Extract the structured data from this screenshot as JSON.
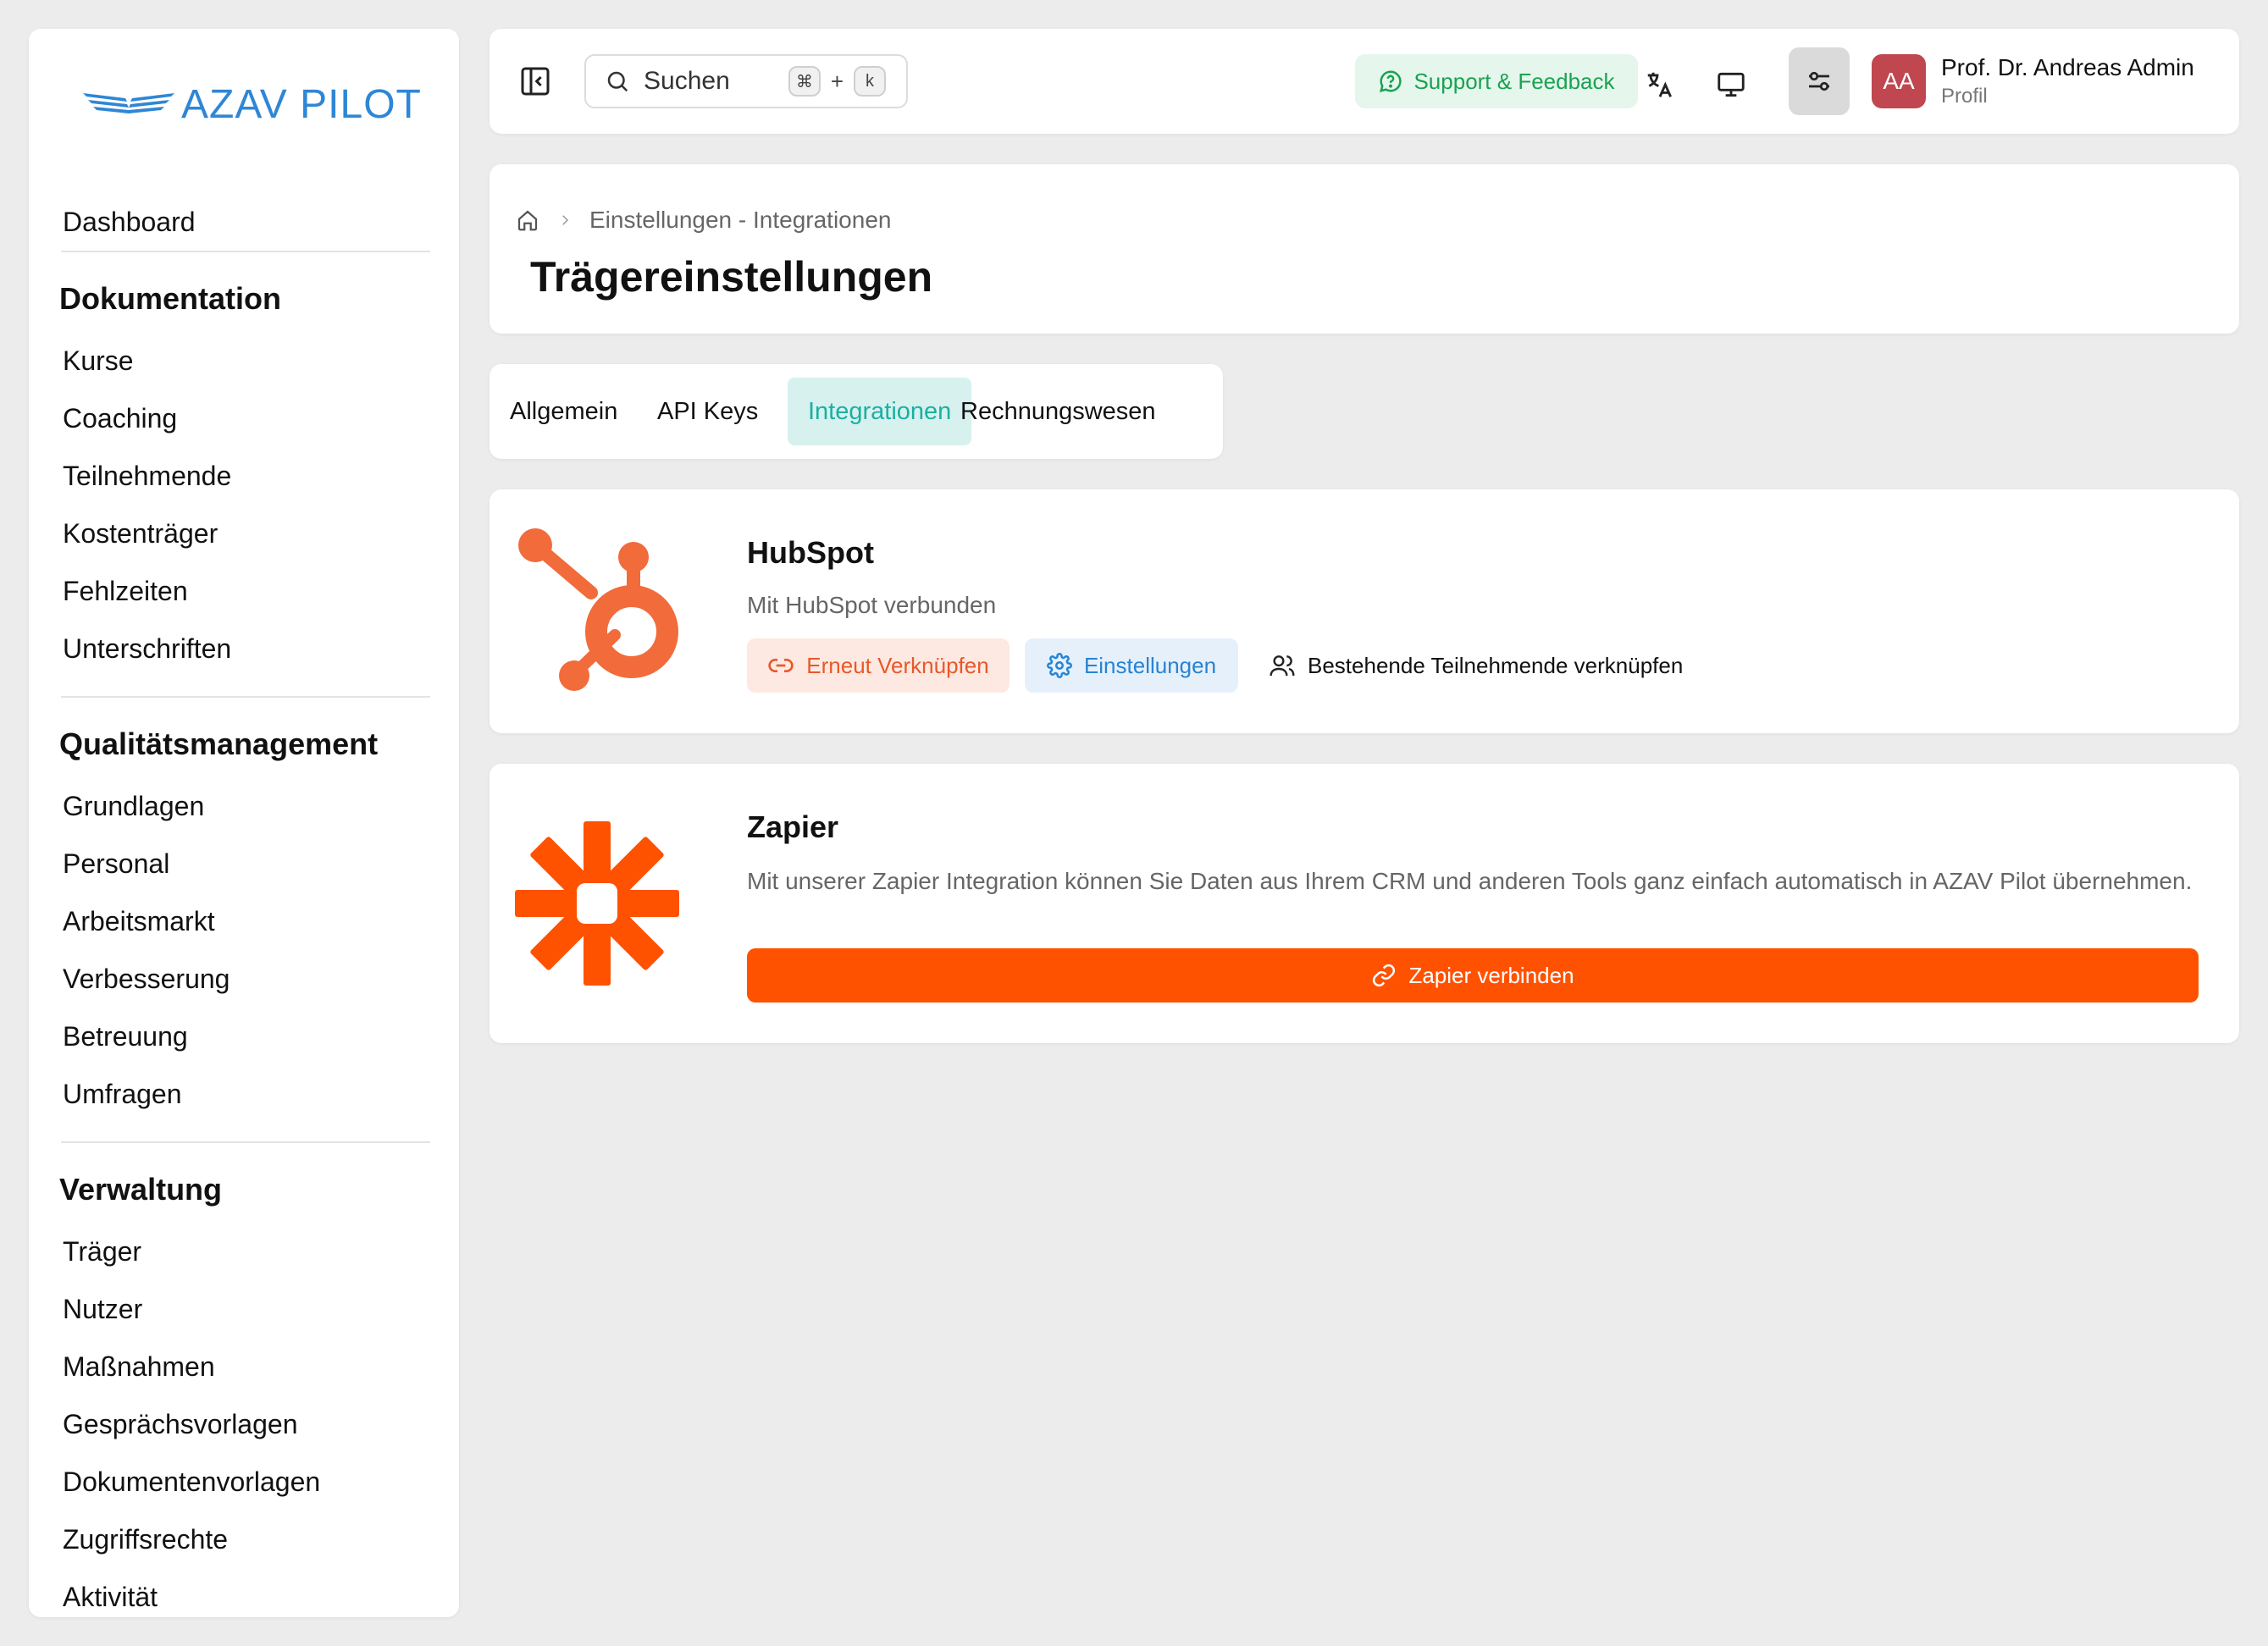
{
  "app": {
    "logo_text": "AZAV PILOT"
  },
  "sidebar": {
    "top_item": "Dashboard",
    "sections": [
      {
        "heading": "Dokumentation",
        "items": [
          "Kurse",
          "Coaching",
          "Teilnehmende",
          "Kostenträger",
          "Fehlzeiten",
          "Unterschriften"
        ]
      },
      {
        "heading": "Qualitätsmanagement",
        "items": [
          "Grundlagen",
          "Personal",
          "Arbeitsmarkt",
          "Verbesserung",
          "Betreuung",
          "Umfragen"
        ]
      },
      {
        "heading": "Verwaltung",
        "items": [
          "Träger",
          "Nutzer",
          "Maßnahmen",
          "Gesprächsvorlagen",
          "Dokumentenvorlagen",
          "Zugriffsrechte",
          "Aktivität"
        ]
      }
    ]
  },
  "topbar": {
    "search_placeholder": "Suchen",
    "shortcut_mod": "⌘",
    "shortcut_plus": "+",
    "shortcut_key": "k",
    "support_label": "Support & Feedback",
    "avatar_initials": "AA",
    "user_name": "Prof. Dr. Andreas Admin",
    "user_sub": "Profil"
  },
  "header": {
    "breadcrumb": "Einstellungen - Integrationen",
    "title": "Trägereinstellungen"
  },
  "tabs": [
    {
      "label": "Allgemein",
      "active": false
    },
    {
      "label": "API Keys",
      "active": false
    },
    {
      "label": "Integrationen",
      "active": true
    },
    {
      "label": "Rechnungswesen",
      "active": false
    }
  ],
  "integrations": {
    "hubspot": {
      "title": "HubSpot",
      "status": "Mit HubSpot verbunden",
      "relink_label": "Erneut Verknüpfen",
      "settings_label": "Einstellungen",
      "link_participants_label": "Bestehende Teilnehmende verknüpfen"
    },
    "zapier": {
      "title": "Zapier",
      "description": "Mit unserer Zapier Integration können Sie Daten aus Ihrem CRM und anderen Tools ganz einfach automatisch in AZAV Pilot übernehmen.",
      "connect_label": "Zapier verbinden"
    }
  },
  "colors": {
    "brand_blue": "#2e86d6",
    "hubspot_orange": "#f26b3a",
    "zapier_orange": "#ff5200",
    "tab_active_bg": "#d7f1ee",
    "tab_active_text": "#1ab0a2",
    "support_green": "#1aa251",
    "avatar_red": "#c0474f"
  }
}
